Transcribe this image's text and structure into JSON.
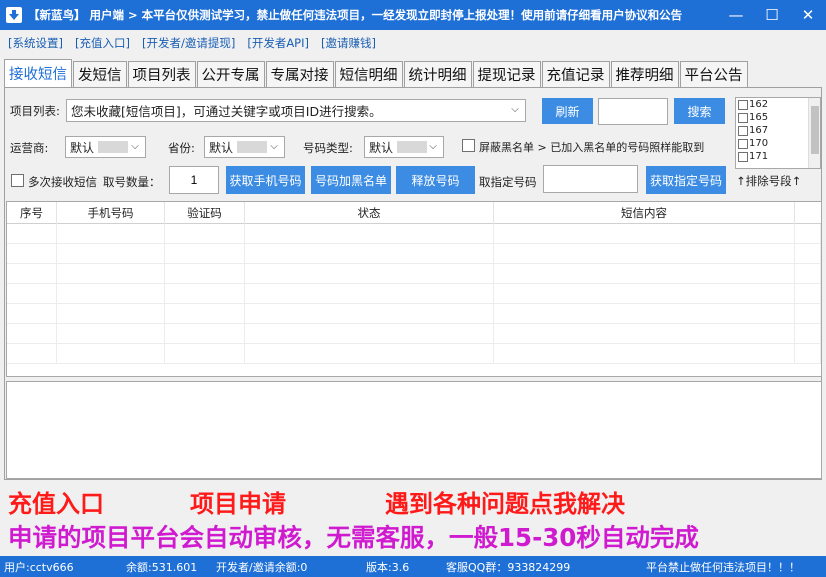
{
  "window": {
    "title": "【新蓝鸟】 用户端 > 本平台仅供测试学习，禁止做任何违法项目，一经发现立即封停上报处理！使用前请仔细看用户协议和公告",
    "minimize": "—",
    "maximize": "☐",
    "close": "✕"
  },
  "menu": [
    "[系统设置]",
    "[充值入口]",
    "[开发者/邀请提现]",
    "[开发者API]",
    "[邀请赚钱]"
  ],
  "tabs": [
    "接收短信",
    "发短信",
    "项目列表",
    "公开专属",
    "专属对接",
    "短信明细",
    "统计明细",
    "提现记录",
    "充值记录",
    "推荐明细",
    "平台公告"
  ],
  "receive": {
    "project_label": "项目列表:",
    "project_value": "您未收藏[短信项目]，可通过关键字或项目ID进行搜索。",
    "refresh": "刷新",
    "search": "搜索",
    "search_value": "",
    "operator_label": "运营商:",
    "operator_value": "默认",
    "province_label": "省份:",
    "province_value": "默认",
    "numtype_label": "号码类型:",
    "numtype_value": "默认",
    "blacklist_label": "屏蔽黑名单 > 已加入黑名单的号码照样能取到",
    "multi_label": "多次接收短信",
    "count_label": "取号数量：",
    "count_value": "1",
    "get_phone": "获取手机号码",
    "add_blacklist": "号码加黑名单",
    "release": "释放号码",
    "specify_label": "取指定号码",
    "specify_value": "",
    "get_specify": "获取指定号码",
    "exclude": "↑排除号段↑",
    "segments": [
      "162",
      "165",
      "167",
      "170",
      "171"
    ]
  },
  "grid": {
    "columns": [
      "序号",
      "手机号码",
      "验证码",
      "状态",
      "短信内容"
    ],
    "rows": []
  },
  "promo": {
    "line1": [
      "充值入口",
      "项目申请",
      "遇到各种问题点我解决"
    ],
    "line2": "申请的项目平台会自动审核，无需客服，一般15-30秒自动完成"
  },
  "status": {
    "user": "用户:cctv666",
    "balance": "余额:531.601",
    "invite": "开发者/邀请余额:0",
    "version": "版本:3.6",
    "qq": "客服QQ群：933824299",
    "notice": "平台禁止做任何违法项目！！！"
  },
  "colors": {
    "titlebar": "#1e6fd6",
    "button": "#3c8ce3",
    "promo_red": "#ff1a1a",
    "promo_magenta": "#d01ad0",
    "menu_link": "#1a5fb4"
  }
}
